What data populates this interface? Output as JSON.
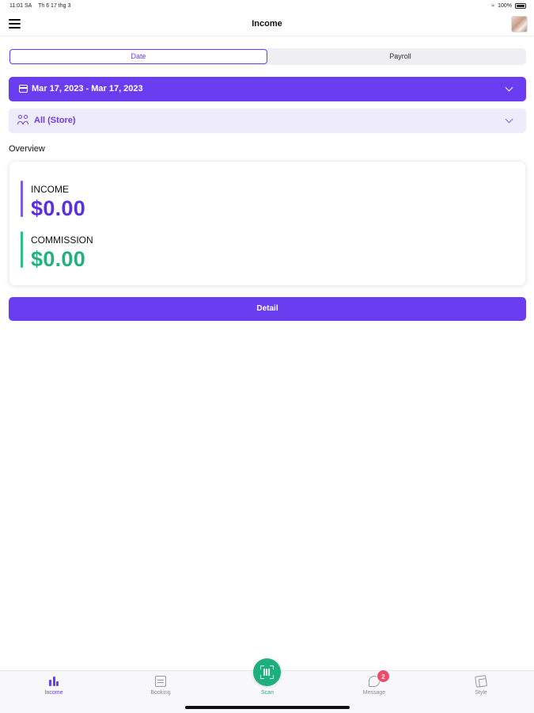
{
  "status_bar": {
    "time": "11:01 SA",
    "date": "Th 6 17 thg 3",
    "battery": "100%"
  },
  "header": {
    "title": "Income"
  },
  "segments": {
    "date": "Date",
    "payroll": "Payroll"
  },
  "filters": {
    "date_range": "Mar 17, 2023 - Mar 17, 2023",
    "store": "All (Store)"
  },
  "overview": {
    "label": "Overview",
    "income_label": "INCOME",
    "income_value": "$0.00",
    "commission_label": "COMMISSION",
    "commission_value": "$0.00"
  },
  "detail_button": "Detail",
  "tabs": {
    "income": "Income",
    "booking": "Booking",
    "scan": "Scan",
    "message": "Message",
    "style": "Style",
    "message_badge": "2"
  },
  "colors": {
    "accent": "#6a3df0",
    "income": "#5a2fe0",
    "commission": "#22b07e",
    "scan": "#1fae7d",
    "badge": "#ee4b6a"
  }
}
